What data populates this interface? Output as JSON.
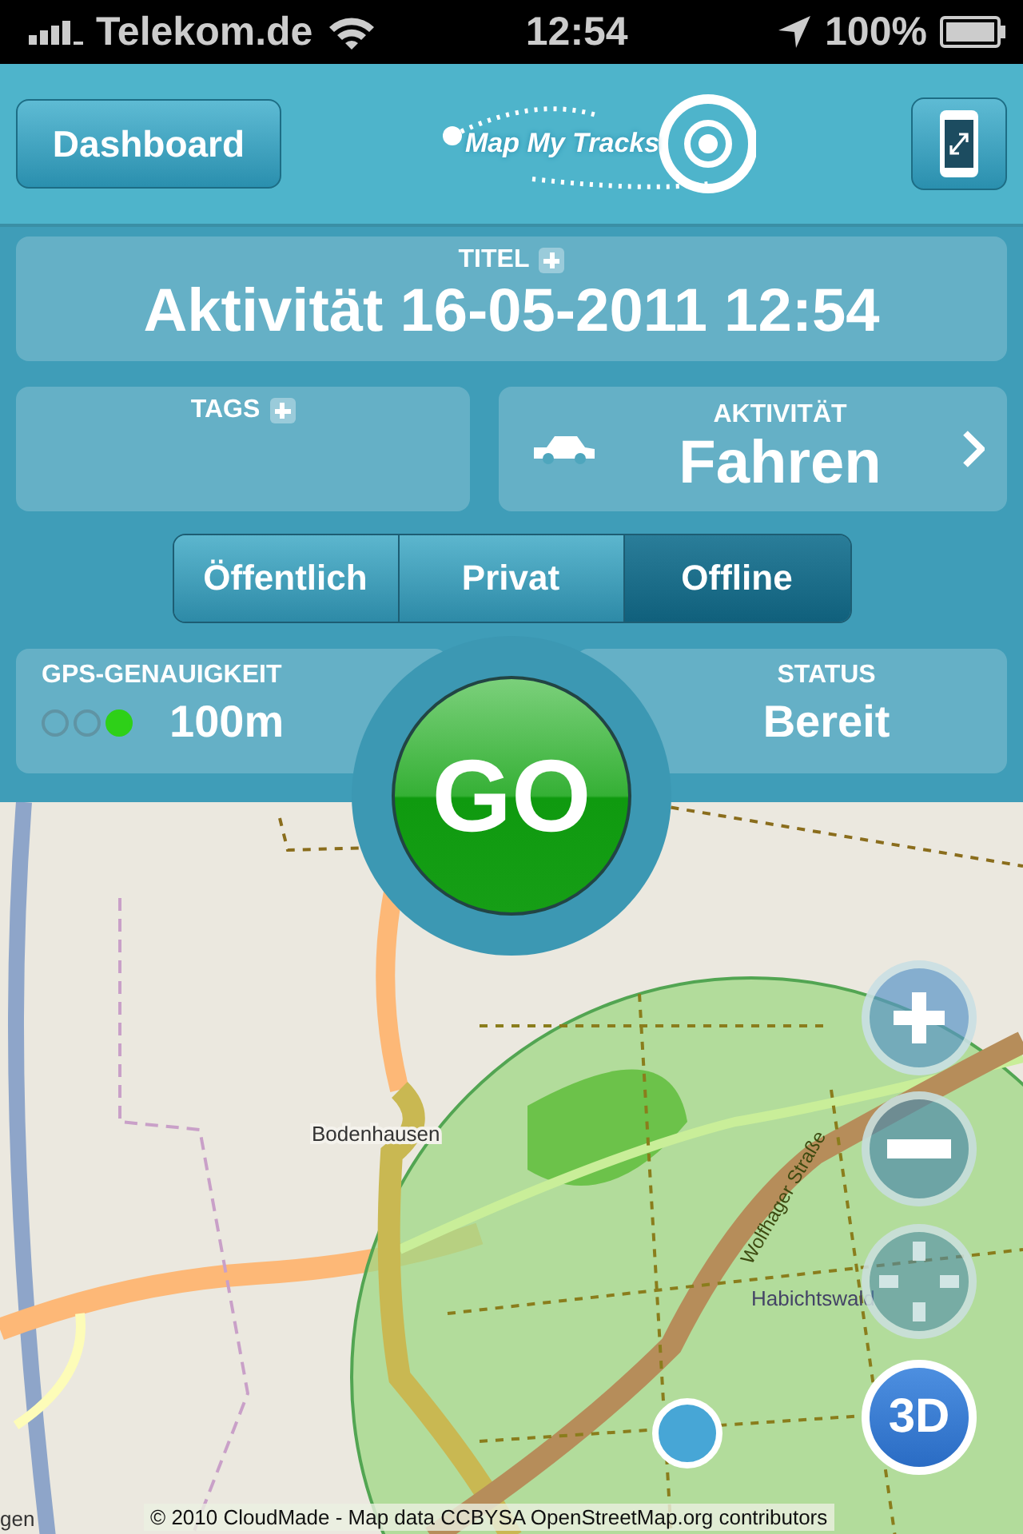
{
  "status_bar": {
    "carrier": "Telekom.de",
    "time": "12:54",
    "battery": "100%"
  },
  "header": {
    "back_button": "Dashboard",
    "logo": "Map My Tracks"
  },
  "title_card": {
    "label": "TITEL",
    "value": "Aktivität 16-05-2011 12:54"
  },
  "tags_card": {
    "label": "TAGS"
  },
  "activity_card": {
    "label": "AKTIVITÄT",
    "value": "Fahren"
  },
  "privacy": [
    {
      "label": "Öffentlich",
      "selected": false
    },
    {
      "label": "Privat",
      "selected": false
    },
    {
      "label": "Offline",
      "selected": true
    }
  ],
  "gps": {
    "label": "GPS-GENAUIGKEIT",
    "dots": [
      {
        "on": false
      },
      {
        "on": false
      },
      {
        "on": true
      }
    ],
    "value": "100m"
  },
  "status": {
    "label": "STATUS",
    "value": "Bereit"
  },
  "go_button": "GO",
  "map": {
    "places": [
      "Bodenhausen",
      "Habichtswald",
      "gen"
    ],
    "road": "Wolfhager Straße",
    "attribution": "© 2010 CloudMade - Map data CCBYSA OpenStreetMap.org contributors",
    "view_button": "3D"
  }
}
